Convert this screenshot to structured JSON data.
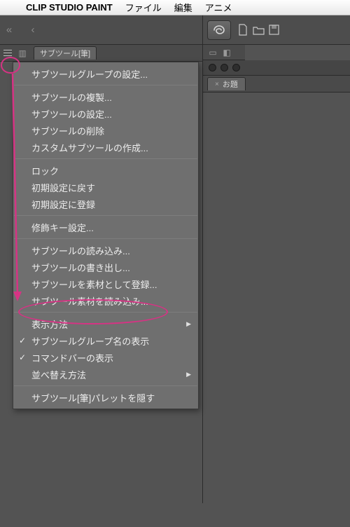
{
  "menubar": {
    "appname": "CLIP STUDIO PAINT",
    "items": [
      "ファイル",
      "編集",
      "アニメ"
    ]
  },
  "palette_tab": {
    "label": "サブツール[筆]"
  },
  "context_menu": {
    "groups": [
      [
        {
          "label": "サブツールグループの設定...",
          "checked": false,
          "sub": false
        }
      ],
      [
        {
          "label": "サブツールの複製...",
          "checked": false,
          "sub": false
        },
        {
          "label": "サブツールの設定...",
          "checked": false,
          "sub": false
        },
        {
          "label": "サブツールの削除",
          "checked": false,
          "sub": false
        },
        {
          "label": "カスタムサブツールの作成...",
          "checked": false,
          "sub": false
        }
      ],
      [
        {
          "label": "ロック",
          "checked": false,
          "sub": false
        },
        {
          "label": "初期設定に戻す",
          "checked": false,
          "sub": false
        },
        {
          "label": "初期設定に登録",
          "checked": false,
          "sub": false
        }
      ],
      [
        {
          "label": "修飾キー設定...",
          "checked": false,
          "sub": false
        }
      ],
      [
        {
          "label": "サブツールの読み込み...",
          "checked": false,
          "sub": false
        },
        {
          "label": "サブツールの書き出し...",
          "checked": false,
          "sub": false
        },
        {
          "label": "サブツールを素材として登録...",
          "checked": false,
          "sub": false
        },
        {
          "label": "サブツール素材を読み込み...",
          "checked": false,
          "sub": false
        }
      ],
      [
        {
          "label": "表示方法",
          "checked": false,
          "sub": true
        },
        {
          "label": "サブツールグループ名の表示",
          "checked": true,
          "sub": false
        },
        {
          "label": "コマンドバーの表示",
          "checked": true,
          "sub": false
        },
        {
          "label": "並べ替え方法",
          "checked": false,
          "sub": true
        }
      ],
      [
        {
          "label": "サブツール[筆]パレットを隠す",
          "checked": false,
          "sub": false
        }
      ]
    ]
  },
  "right_panel": {
    "tab_label": "お題"
  }
}
